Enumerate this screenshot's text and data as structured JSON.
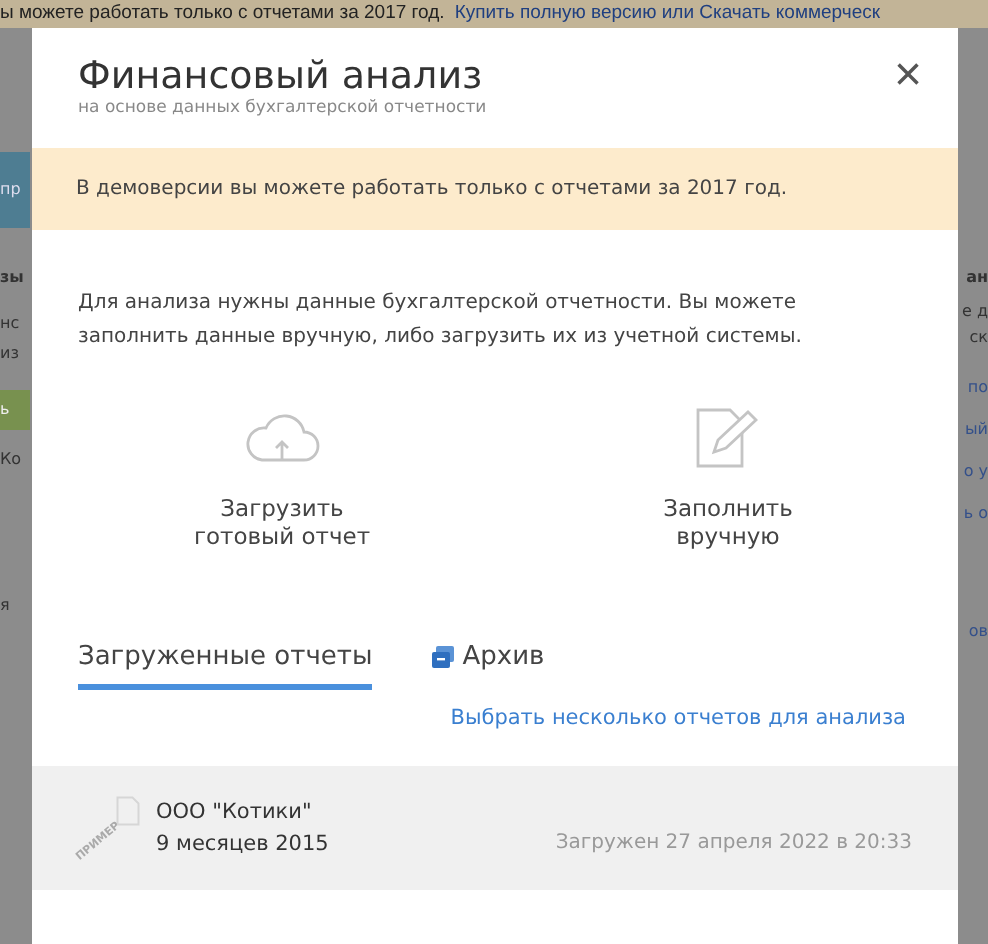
{
  "background": {
    "notice": "ы можете работать только с отчетами за 2017 год.",
    "notice_link": "Купить полную версию или Скачать коммерческ",
    "left": [
      {
        "text": "пр",
        "kind": "bar"
      },
      {
        "text": "зы",
        "kind": "heading"
      },
      {
        "text": "нс",
        "kind": "text"
      },
      {
        "text": "из",
        "kind": "text"
      },
      {
        "text": "ь",
        "kind": "button"
      },
      {
        "text": "Ко",
        "kind": "text"
      },
      {
        "text": "я",
        "kind": "text"
      }
    ],
    "right": [
      {
        "text": "ан",
        "kind": "heading"
      },
      {
        "text": "е д",
        "kind": "text"
      },
      {
        "text": "ск",
        "kind": "text"
      },
      {
        "text": "по",
        "kind": "link"
      },
      {
        "text": "ый",
        "kind": "link"
      },
      {
        "text": "о у",
        "kind": "link"
      },
      {
        "text": "ь о",
        "kind": "link"
      },
      {
        "text": "ов",
        "kind": "link"
      }
    ]
  },
  "dialog": {
    "title": "Финансовый анализ",
    "subtitle": "на основе данных бухгалтерской отчетности",
    "close": "×",
    "warning": "В демоверсии вы можете работать только с отчетами за 2017 год.",
    "intro": "Для анализа нужны данные бухгалтерской отчетности. Вы можете заполнить данные вручную, либо загрузить их из учетной системы.",
    "actions": [
      {
        "kind": "upload",
        "label": "Загрузить готовый отчет"
      },
      {
        "kind": "manual",
        "label": "Заполнить вручную"
      }
    ],
    "tabs": [
      {
        "label": "Загруженные отчеты",
        "selected": true,
        "kind": "plain"
      },
      {
        "label": "Архив",
        "selected": false,
        "kind": "archive"
      }
    ],
    "select_link": "Выбрать несколько отчетов для анализа",
    "reports": [
      {
        "badge": "ПРИМЕР",
        "company": "ООО \"Котики\"",
        "period": "9 месяцев 2015",
        "uploaded": "Загружен 27 апреля 2022 в 20:33"
      }
    ]
  }
}
